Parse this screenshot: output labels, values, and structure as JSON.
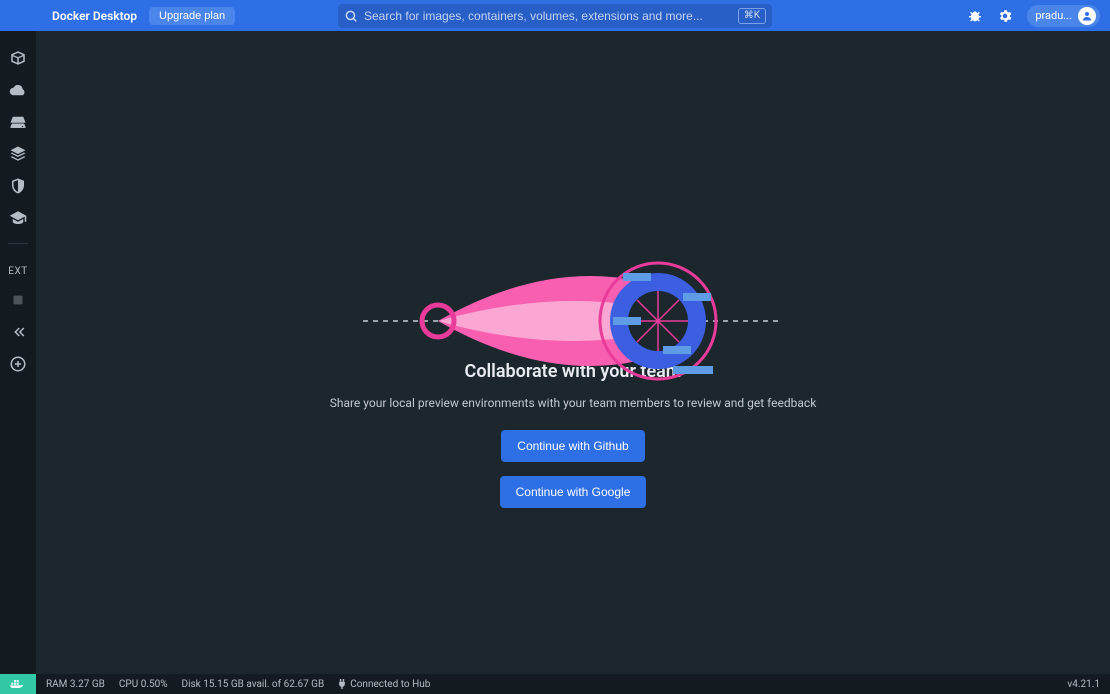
{
  "header": {
    "app_title": "Docker Desktop",
    "upgrade_label": "Upgrade plan",
    "search_placeholder": "Search for images, containers, volumes, extensions and more...",
    "search_kbd": "⌘K",
    "username": "pradu..."
  },
  "sidebar": {
    "ext_label": "EXT"
  },
  "main": {
    "title": "Collaborate with your team",
    "subtitle": "Share your local preview environments with your team members to review and get feedback",
    "github_btn": "Continue with Github",
    "google_btn": "Continue with Google"
  },
  "footer": {
    "ram": "RAM 3.27 GB",
    "cpu": "CPU 0.50%",
    "disk": "Disk 15.15 GB avail. of 62.67 GB",
    "hub": "Connected to Hub",
    "version": "v4.21.1"
  }
}
